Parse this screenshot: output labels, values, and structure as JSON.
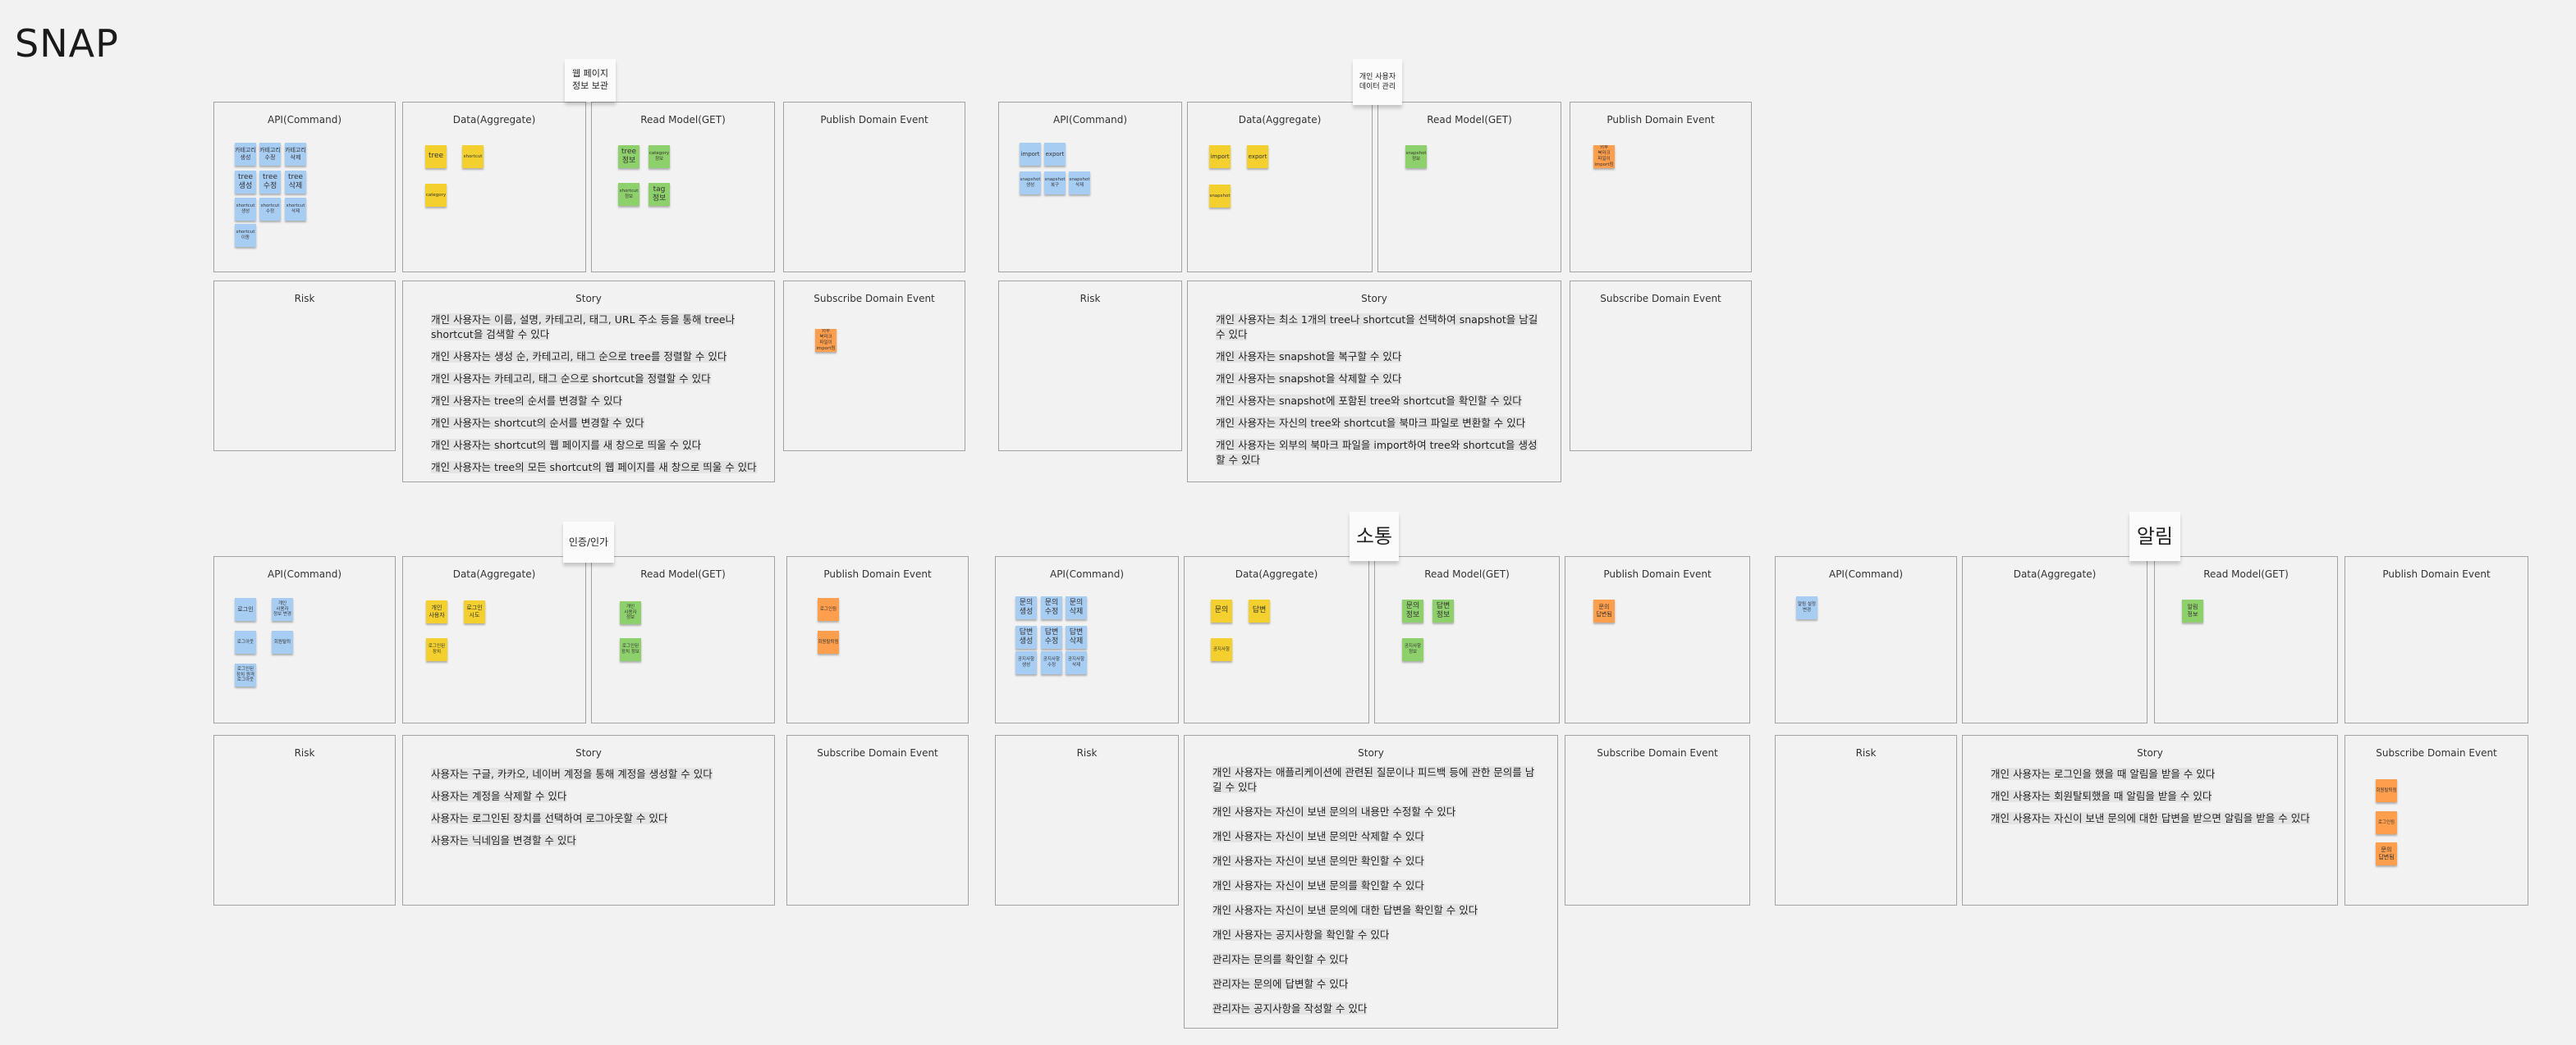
{
  "app_title": "SNAP",
  "labels": {
    "api": "API(Command)",
    "data": "Data(Aggregate)",
    "read": "Read Model(GET)",
    "publish": "Publish Domain Event",
    "risk": "Risk",
    "story": "Story",
    "subscribe": "Subscribe Domain Event"
  },
  "colors": {
    "command": "#a8cdf3",
    "aggregate": "#f3d02e",
    "read_model": "#8ed06b",
    "event": "#ff9f4e",
    "background": "#f2f2f2"
  },
  "boards": [
    {
      "title": "웹 페이지\n정보 보관",
      "api": [
        "카테고리\n생성",
        "카테고리\n수정",
        "카테고리\n삭제",
        "tree\n생성",
        "tree\n수정",
        "tree\n삭제",
        "shortcut\n생성",
        "shortcut\n수정",
        "shortcut\n삭제",
        "shortcut\n이동"
      ],
      "data": [
        "tree",
        "shortcut",
        "category"
      ],
      "read": [
        "tree\n정보",
        "category\n정보",
        "shortcut\n정보",
        "tag\n정보"
      ],
      "publish": [],
      "subscribe": [
        "외부 북마크\n파일이\nimport됨"
      ],
      "story": [
        "개인 사용자는 이름, 설명, 카테고리, 태그, URL 주소 등을 통해 tree나 shortcut을 검색할 수 있다",
        "개인 사용자는 생성 순, 카테고리, 태그 순으로 tree를 정렬할 수 있다",
        "개인 사용자는 카테고리, 태그 순으로 shortcut을 정렬할 수 있다",
        "개인 사용자는 tree의 순서를 변경할 수 있다",
        "개인 사용자는 shortcut의 순서를 변경할 수 있다",
        "개인 사용자는 shortcut의 웹 페이지를 새 창으로 띄울 수 있다",
        "개인 사용자는 tree의 모든 shortcut의 웹 페이지를 새 창으로 띄울 수 있다"
      ]
    },
    {
      "title": "개인 사용자\n데이터 관리",
      "api": [
        "import",
        "export",
        "snapshot\n생성",
        "snapshot\n복구",
        "snapshot\n삭제"
      ],
      "data": [
        "import",
        "export",
        "snapshot"
      ],
      "read": [
        "snapshot\n정보"
      ],
      "publish": [
        "외부 북마크\n파일이\nimport됨"
      ],
      "subscribe": [],
      "story": [
        "개인 사용자는 최소 1개의 tree나 shortcut을 선택하여 snapshot을 남길 수 있다",
        "개인 사용자는 snapshot을 복구할 수 있다",
        "개인 사용자는 snapshot을 삭제할 수 있다",
        "개인 사용자는 snapshot에 포함된 tree와 shortcut을 확인할 수 있다",
        "개인 사용자는 자신의 tree와 shortcut을 북마크 파일로 변환할 수 있다",
        "개인 사용자는 외부의 북마크 파일을 import하여 tree와 shortcut을 생성할 수 있다"
      ]
    },
    {
      "title": "인증/인가",
      "api": [
        "로그인",
        "개인\n사용자\n정보 변경",
        "로그아웃",
        "회원탈퇴",
        "로그인된\n장치 원격\n로그아웃"
      ],
      "data": [
        "개인\n사용자",
        "로그인\n시도",
        "로그인된\n장치"
      ],
      "read": [
        "개인\n사용자\n정보",
        "로그인된\n장치 정보"
      ],
      "publish": [
        "로그인됨",
        "회원탈퇴됨"
      ],
      "subscribe": [],
      "story": [
        "사용자는 구글, 카카오, 네이버 계정을 통해 계정을 생성할 수 있다",
        "사용자는 계정을 삭제할 수 있다",
        "사용자는 로그인된 장치를 선택하여 로그아웃할 수 있다",
        "사용자는 닉네임을 변경할 수 있다"
      ]
    },
    {
      "title": "소통",
      "api": [
        "문의\n생성",
        "문의\n수정",
        "문의\n삭제",
        "답변\n생성",
        "답변\n수정",
        "답변\n삭제",
        "공지사항\n생성",
        "공지사항\n수정",
        "공지사항\n삭제"
      ],
      "data": [
        "문의",
        "답변",
        "공지사항"
      ],
      "read": [
        "문의\n정보",
        "답변\n정보",
        "공지사항\n정보"
      ],
      "publish": [
        "문의\n답변됨"
      ],
      "subscribe": [],
      "story": [
        "개인 사용자는 애플리케이션에 관련된 질문이나 피드백 등에 관한 문의를 남길 수 있다",
        "개인 사용자는 자신이 보낸 문의의 내용만 수정할 수 있다",
        "개인 사용자는 자신이 보낸 문의만 삭제할 수 있다",
        "개인 사용자는 자신이 보낸 문의만 확인할 수 있다",
        "개인 사용자는 자신이 보낸 문의를 확인할 수 있다",
        "개인 사용자는 자신이 보낸 문의에 대한 답변을 확인할 수 있다",
        "개인 사용자는 공지사항을 확인할 수 있다",
        "관리자는 문의를 확인할 수 있다",
        "관리자는 문의에 답변할 수 있다",
        "관리자는 공지사항을 작성할 수 있다"
      ]
    },
    {
      "title": "알림",
      "api": [
        "알림 설정\n변경"
      ],
      "data": [],
      "read": [
        "알림\n정보"
      ],
      "publish": [],
      "subscribe": [
        "회원탈퇴됨",
        "로그인됨",
        "문의\n답변됨"
      ],
      "story": [
        "개인 사용자는 로그인을 했을 때 알림을 받을 수 있다",
        "개인 사용자는 회원탈퇴했을 때 알림을 받을 수 있다",
        "개인 사용자는 자신이 보낸 문의에 대한 답변을 받으면 알림을 받을 수 있다"
      ]
    }
  ]
}
